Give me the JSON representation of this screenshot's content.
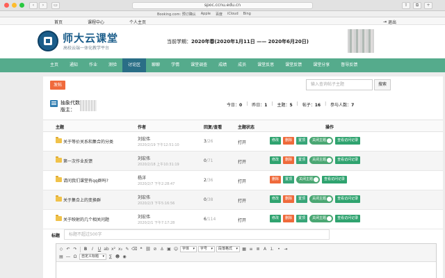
{
  "browser": {
    "url": "spoc.ccnu.edu.cn",
    "favorites": [
      "Booking.com: 预订确认",
      "Apple",
      "百度",
      "iCloud",
      "Bing"
    ],
    "traffic_colors": [
      "#ff5f57",
      "#febc2e",
      "#28c840"
    ]
  },
  "topnav": {
    "links": [
      "首页",
      "课程中心",
      "个人主页"
    ],
    "logout": "退出"
  },
  "header": {
    "site_name": "师大云课堂",
    "site_sub": "高校云端一体化教学平台",
    "semester_label": "当前学期：",
    "semester_value": "2020年春(2020年1月11日 —— 2020年6月20日)"
  },
  "nav": {
    "items": [
      "主页",
      "通知",
      "作业",
      "测验",
      "讨论区",
      "聊聊",
      "学情",
      "课堂调查",
      "成绩",
      "成员",
      "课堂反思",
      "课堂反馈",
      "课堂分享",
      "督导反馈"
    ],
    "active_index": 4
  },
  "toolbar": {
    "post_label": "发帖",
    "search_placeholder": "输入查询帖子主题",
    "search_label": "搜索"
  },
  "forum": {
    "name": "抽象代数",
    "moderator_label": "版主：",
    "stats": {
      "today_label": "今日：",
      "today": "0",
      "yesterday_label": "昨日：",
      "yesterday": "1",
      "topics_label": "主题：",
      "topics": "5",
      "posts_label": "帖子：",
      "posts": "16",
      "participants_label": "参与人数：",
      "participants": "7"
    }
  },
  "table": {
    "headers": [
      "主题",
      "作者",
      "回复/查看",
      "主题状态",
      "操作"
    ],
    "rows": [
      {
        "title": "关于等价关系和集合的分类",
        "author": "刘宏伟",
        "time": "2020/2/19 下午12:51:10",
        "replies": "3",
        "views": "/26",
        "status": "打开",
        "ops": [
          "修改",
          "删除",
          "置顶"
        ],
        "toggle": "关闭主题",
        "view": "查看访问记录"
      },
      {
        "title": "第一次作业反馈",
        "author": "刘宏伟",
        "time": "2020/2/18 上午10:31:19",
        "replies": "0",
        "views": "/71",
        "status": "打开",
        "ops": [
          "修改",
          "删除",
          "置顶"
        ],
        "toggle": "关闭主题",
        "view": "查看访问记录"
      },
      {
        "title": "请问我们课堂有qq群吗?",
        "author": "杨洋",
        "time": "2020/2/7 下午2:28:47",
        "replies": "2",
        "views": "/36",
        "status": "打开",
        "ops": [
          "删除",
          "置顶"
        ],
        "toggle": "关闭主题",
        "view": "查看访问记录"
      },
      {
        "title": "关于集合上的变换群",
        "author": "刘宏伟",
        "time": "2020/2/3 下午5:16:56",
        "replies": "0",
        "views": "/38",
        "status": "打开",
        "ops": [
          "修改",
          "删除",
          "置顶"
        ],
        "toggle": "关闭主题",
        "view": "查看访问记录"
      },
      {
        "title": "关于映射的几个相关问题",
        "author": "刘宏伟",
        "time": "2020/2/1 下午7:17:28",
        "replies": "6",
        "views": "/114",
        "status": "打开",
        "ops": [
          "修改",
          "删除",
          "置顶"
        ],
        "toggle": "关闭主题",
        "view": "查看访问记录"
      }
    ]
  },
  "composer": {
    "title_label": "标题",
    "title_placeholder": "标题不超过500字",
    "font_select": "字体",
    "size_select": "字号",
    "para_select": "段落格式",
    "custom_label": "自定义标题"
  }
}
